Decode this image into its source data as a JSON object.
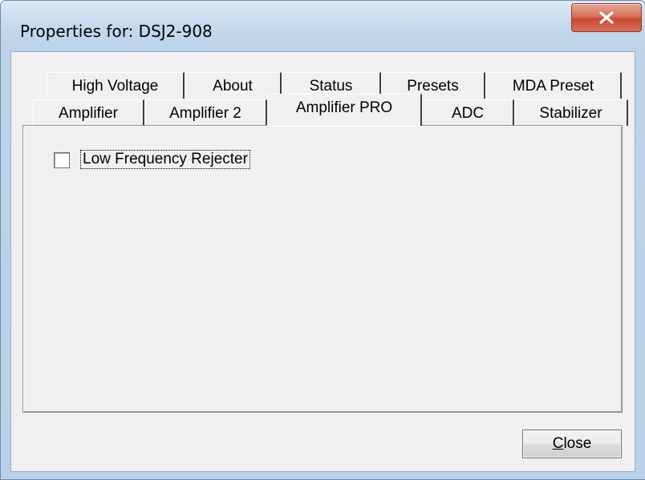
{
  "window": {
    "title": "Properties for: DSJ2-908"
  },
  "tabs": {
    "row1": [
      {
        "label": "High Voltage"
      },
      {
        "label": "About"
      },
      {
        "label": "Status"
      },
      {
        "label": "Presets"
      },
      {
        "label": "MDA Preset"
      }
    ],
    "row2": [
      {
        "label": "Amplifier"
      },
      {
        "label": "Amplifier 2"
      },
      {
        "label": "Amplifier PRO"
      },
      {
        "label": "ADC"
      },
      {
        "label": "Stabilizer"
      }
    ],
    "active": "Amplifier PRO"
  },
  "panel": {
    "low_freq_checkbox": {
      "label": "Low Frequency Rejecter",
      "checked": false
    }
  },
  "footer": {
    "close_button": {
      "mnemonic": "C",
      "rest": "lose"
    }
  },
  "icons": {
    "window_close": "close-x-icon"
  },
  "colors": {
    "close_button_red": "#c84a31",
    "title_bar": "#c4d8ed",
    "dialog_bg": "#f0f0f0"
  }
}
